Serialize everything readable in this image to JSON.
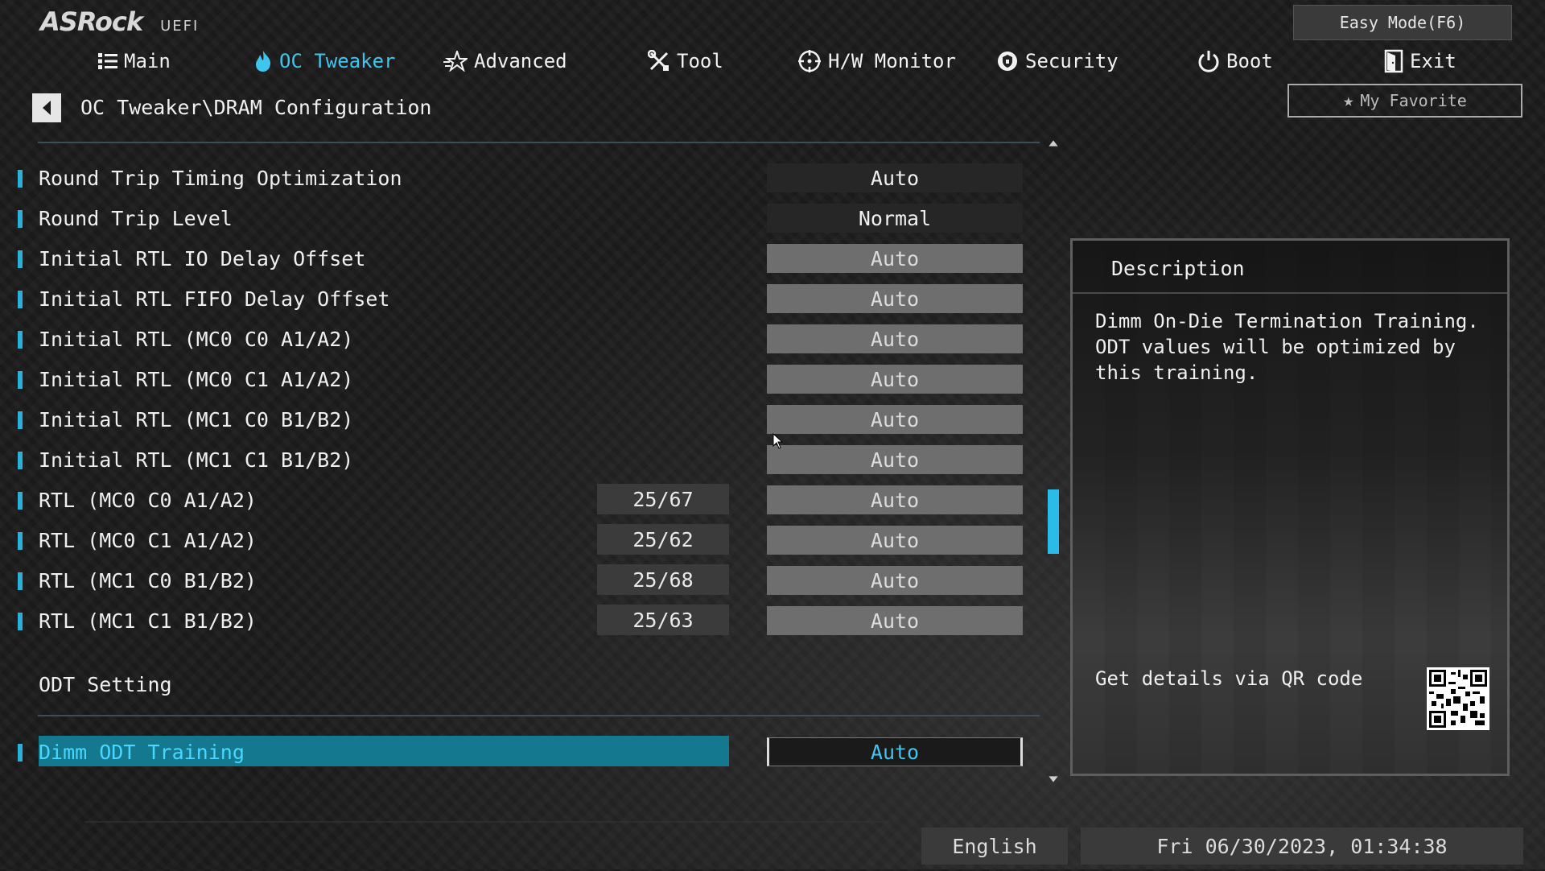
{
  "logo": {
    "brand": "ASRock",
    "sub": "UEFI"
  },
  "easy_mode_label": "Easy Mode(F6)",
  "favorite_label": "My Favorite",
  "nav": [
    {
      "label": "Main",
      "icon": "list-icon"
    },
    {
      "label": "OC Tweaker",
      "icon": "flame-icon",
      "active": true
    },
    {
      "label": "Advanced",
      "icon": "star-icon"
    },
    {
      "label": "Tool",
      "icon": "tools-icon"
    },
    {
      "label": "H/W Monitor",
      "icon": "target-icon"
    },
    {
      "label": "Security",
      "icon": "shield-icon"
    },
    {
      "label": "Boot",
      "icon": "power-icon"
    },
    {
      "label": "Exit",
      "icon": "exit-door-icon"
    }
  ],
  "breadcrumb": "OC Tweaker\\DRAM Configuration",
  "rows": [
    {
      "label": "Round Trip Timing Optimization",
      "value": "Auto",
      "style": "dark"
    },
    {
      "label": "Round Trip Level",
      "value": "Normal",
      "style": "dark"
    },
    {
      "label": "Initial RTL IO Delay Offset",
      "value": "Auto",
      "style": "light"
    },
    {
      "label": "Initial RTL FIFO Delay Offset",
      "value": "Auto",
      "style": "light"
    },
    {
      "label": "Initial RTL (MC0 C0 A1/A2)",
      "value": "Auto",
      "style": "light"
    },
    {
      "label": "Initial RTL (MC0 C1 A1/A2)",
      "value": "Auto",
      "style": "light"
    },
    {
      "label": "Initial RTL (MC1 C0 B1/B2)",
      "value": "Auto",
      "style": "light"
    },
    {
      "label": "Initial RTL (MC1 C1 B1/B2)",
      "value": "Auto",
      "style": "light"
    },
    {
      "label": "RTL (MC0 C0 A1/A2)",
      "current": "25/67",
      "value": "Auto",
      "style": "light"
    },
    {
      "label": "RTL (MC0 C1 A1/A2)",
      "current": "25/62",
      "value": "Auto",
      "style": "light"
    },
    {
      "label": "RTL (MC1 C0 B1/B2)",
      "current": "25/68",
      "value": "Auto",
      "style": "light"
    },
    {
      "label": "RTL (MC1 C1 B1/B2)",
      "current": "25/63",
      "value": "Auto",
      "style": "light"
    }
  ],
  "section_title": "ODT Setting",
  "selected_row": {
    "label": "Dimm ODT Training",
    "value": "Auto"
  },
  "description": {
    "title": "Description",
    "text": "Dimm On-Die Termination Training. ODT values will be optimized by this training.",
    "qr_label": "Get details via QR code"
  },
  "footer": {
    "language": "English",
    "datetime": "Fri 06/30/2023, 01:34:38"
  },
  "colors": {
    "accent": "#3ec6f0",
    "selected_bg": "#14798f",
    "marker": "#2bb0d8"
  }
}
